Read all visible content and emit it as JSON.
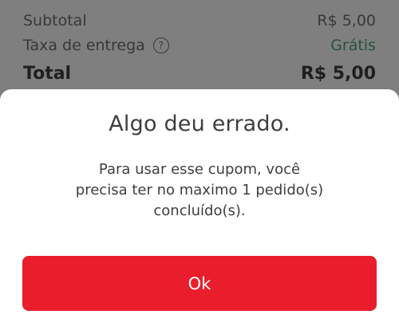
{
  "summary": {
    "subtotal_label": "Subtotal",
    "subtotal_value": "R$ 5,00",
    "fee_label": "Taxa de entrega",
    "fee_help_icon": "question-mark-circle",
    "fee_value": "Grátis",
    "total_label": "Total",
    "total_value": "R$ 5,00"
  },
  "dialog": {
    "title": "Algo deu errado.",
    "message": "Para usar esse cupom, você precisa ter no maximo 1 pedido(s) concluído(s).",
    "ok_label": "Ok"
  },
  "colors": {
    "accent_red": "#ea1d2c",
    "free_green": "#50a773",
    "text_dark": "#3e3e3e"
  }
}
